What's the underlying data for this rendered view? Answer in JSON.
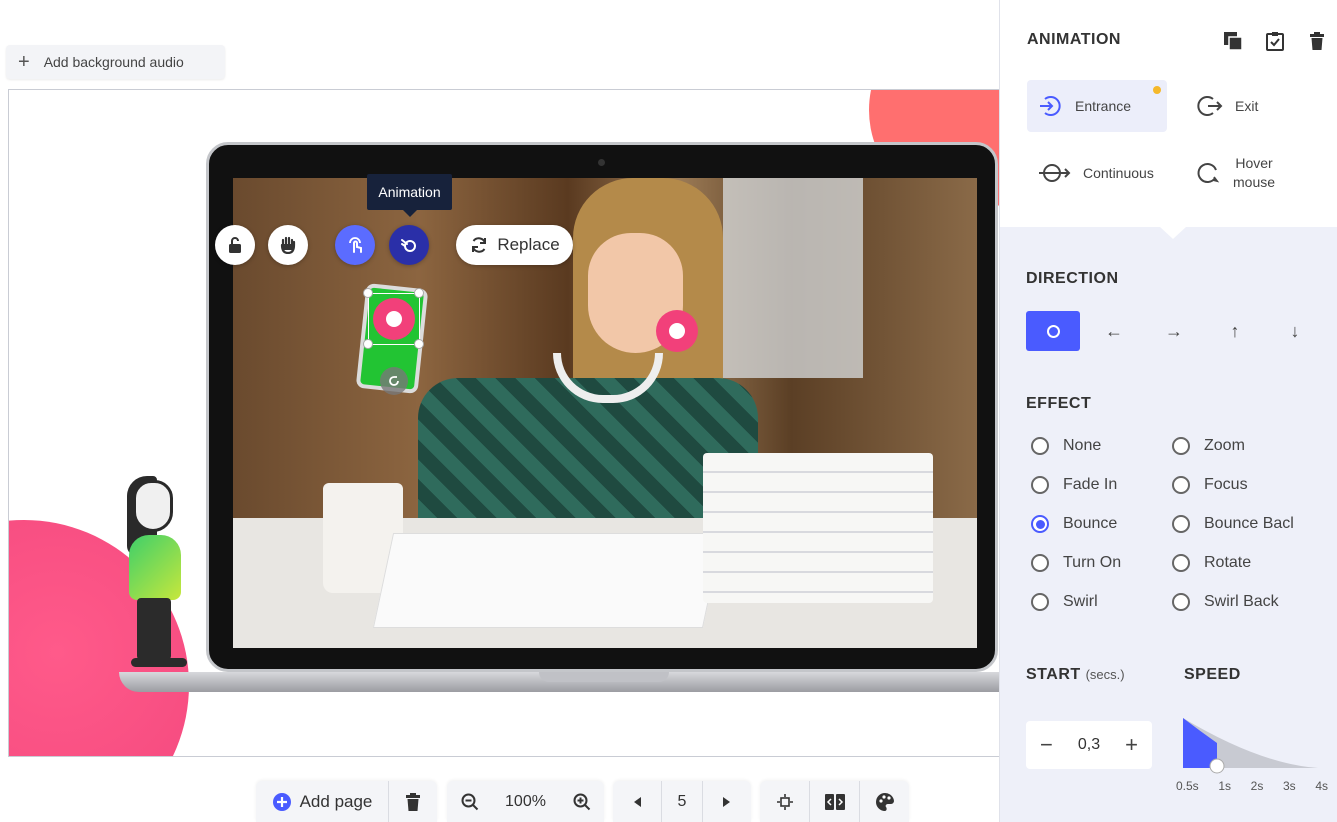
{
  "top": {
    "add_audio_label": "Add background audio"
  },
  "canvas": {
    "tooltip": "Animation",
    "replace_label": "Replace"
  },
  "bottom": {
    "add_page_label": "Add page",
    "zoom": "100%",
    "page_number": "5"
  },
  "panel": {
    "title": "ANIMATION",
    "types": {
      "entrance": "Entrance",
      "exit": "Exit",
      "continuous": "Continuous",
      "hover_line1": "Hover",
      "hover_line2": "mouse"
    },
    "direction_title": "DIRECTION",
    "effect_title": "EFFECT",
    "effects_left": [
      "None",
      "Fade In",
      "Bounce",
      "Turn On",
      "Swirl"
    ],
    "effects_right": [
      "Zoom",
      "Focus",
      "Bounce Bacl",
      "Rotate",
      "Swirl Back"
    ],
    "selected_effect": "Bounce",
    "start_title": "START",
    "start_unit": "(secs.)",
    "start_value": "0,3",
    "speed_title": "SPEED",
    "speed_ticks": [
      "0.5s",
      "1s",
      "2s",
      "3s",
      "4s"
    ],
    "speed_selected": "1s"
  },
  "colors": {
    "accent": "#4a5bff",
    "navy": "#2a2fa8",
    "hotspot": "#f2407a",
    "badge": "#f5b82a"
  }
}
